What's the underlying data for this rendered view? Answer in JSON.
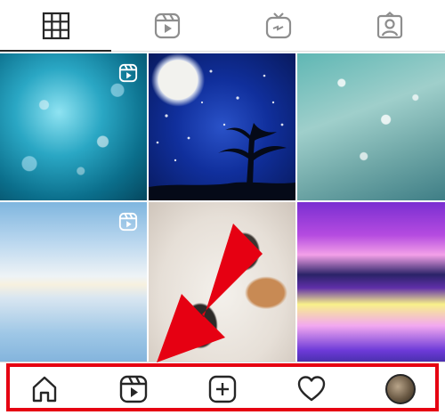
{
  "top_tabs": [
    {
      "id": "grid",
      "icon": "grid-icon",
      "active": true
    },
    {
      "id": "reels",
      "icon": "reels-icon",
      "active": false
    },
    {
      "id": "igtv",
      "icon": "igtv-icon",
      "active": false
    },
    {
      "id": "tagged",
      "icon": "tagged-person-icon",
      "active": false
    }
  ],
  "posts": [
    {
      "thumb": "underwater-bubbles",
      "is_reel": true
    },
    {
      "thumb": "night-sky-moon-tree",
      "is_reel": false
    },
    {
      "thumb": "water-droplets-plants",
      "is_reel": false
    },
    {
      "thumb": "sky-reflection-horizon",
      "is_reel": true
    },
    {
      "thumb": "sleeping-cat",
      "is_reel": false
    },
    {
      "thumb": "purple-sunset-lake",
      "is_reel": false
    }
  ],
  "bottom_nav": [
    {
      "id": "home",
      "icon": "home-icon"
    },
    {
      "id": "reels",
      "icon": "reels-icon"
    },
    {
      "id": "create",
      "icon": "add-post-icon"
    },
    {
      "id": "activity",
      "icon": "heart-icon"
    },
    {
      "id": "profile",
      "icon": "profile-avatar"
    }
  ],
  "annotation": {
    "highlight_color": "#e60012",
    "arrow_color": "#e60012",
    "target": "bottom_nav"
  }
}
